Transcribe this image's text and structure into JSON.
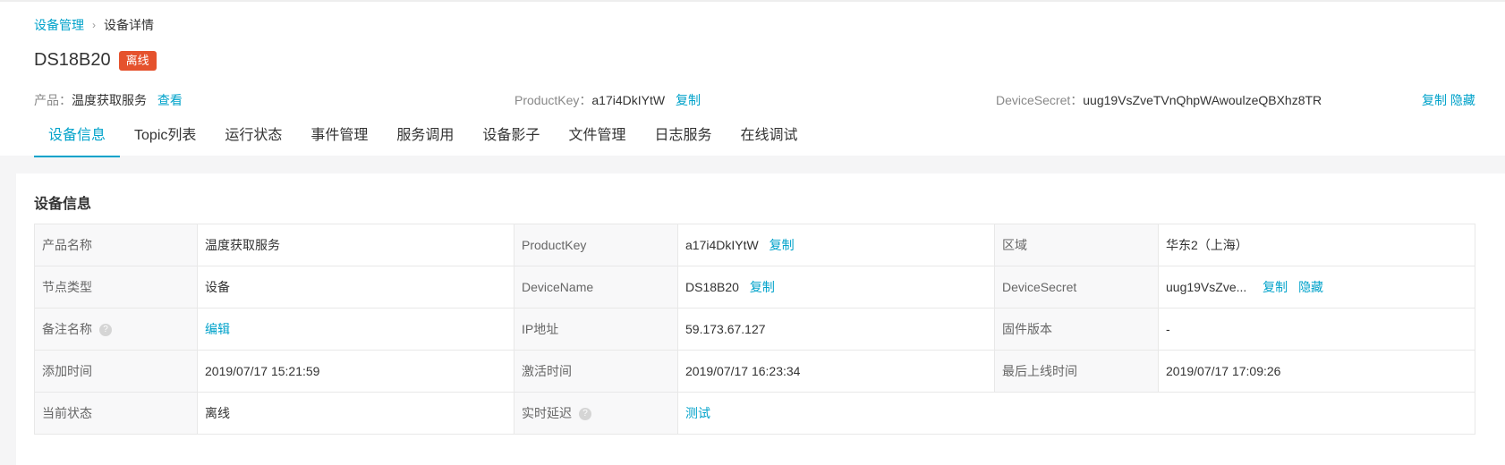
{
  "breadcrumb": {
    "parent": "设备管理",
    "separator": "›",
    "current": "设备详情"
  },
  "device": {
    "name": "DS18B20",
    "status_badge": "离线"
  },
  "meta": {
    "product_label": "产品：",
    "product_value": "温度获取服务",
    "product_view": "查看",
    "productkey_label": "ProductKey：",
    "productkey_value": "a17i4DkIYtW",
    "productkey_copy": "复制",
    "secret_label": "DeviceSecret：",
    "secret_value": "uug19VsZveTVnQhpWAwoulzeQBXhz8TR",
    "secret_copy": "复制",
    "secret_hide": "隐藏"
  },
  "tabs": [
    "设备信息",
    "Topic列表",
    "运行状态",
    "事件管理",
    "服务调用",
    "设备影子",
    "文件管理",
    "日志服务",
    "在线调试"
  ],
  "panel": {
    "title": "设备信息",
    "labels": {
      "product_name": "产品名称",
      "productkey": "ProductKey",
      "region": "区域",
      "node_type": "节点类型",
      "devicename": "DeviceName",
      "devicesecret": "DeviceSecret",
      "remark": "备注名称",
      "ip": "IP地址",
      "firmware": "固件版本",
      "added": "添加时间",
      "activated": "激活时间",
      "last_online": "最后上线时间",
      "state": "当前状态",
      "latency": "实时延迟"
    },
    "values": {
      "product_name": "温度获取服务",
      "productkey": "a17i4DkIYtW",
      "region": "华东2（上海）",
      "node_type": "设备",
      "devicename": "DS18B20",
      "devicesecret": "uug19VsZve...",
      "remark_edit": "编辑",
      "ip": "59.173.67.127",
      "firmware": "-",
      "added": "2019/07/17 15:21:59",
      "activated": "2019/07/17 16:23:34",
      "last_online": "2019/07/17 17:09:26",
      "state": "离线",
      "latency_test": "测试"
    },
    "actions": {
      "copy": "复制",
      "hide": "隐藏",
      "help": "?"
    }
  }
}
